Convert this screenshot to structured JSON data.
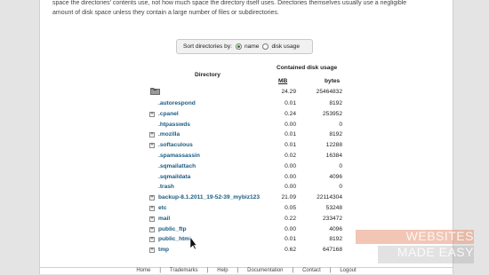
{
  "intro_lines": [
    "space the directories' contents use, not how much space the directory itself uses. Directories themselves usually use a negligible",
    "amount of disk space unless they contain a large number of files or subdirectories."
  ],
  "sort": {
    "label": "Sort directories by:",
    "options": [
      "name",
      "disk usage"
    ],
    "selected": "name"
  },
  "table": {
    "col_directory": "Directory",
    "col_usage": "Contained disk usage",
    "col_mb": "MB",
    "col_bytes": "bytes",
    "root": {
      "mb": "24.29",
      "bytes": "25464832"
    },
    "rows": [
      {
        "name": ".autorespond",
        "mb": "0.01",
        "bytes": "8192",
        "expandable": false
      },
      {
        "name": ".cpanel",
        "mb": "0.24",
        "bytes": "253952",
        "expandable": true
      },
      {
        "name": ".htpasswds",
        "mb": "0.00",
        "bytes": "0",
        "expandable": false
      },
      {
        "name": ".mozilla",
        "mb": "0.01",
        "bytes": "8192",
        "expandable": true
      },
      {
        "name": ".softaculous",
        "mb": "0.01",
        "bytes": "12288",
        "expandable": true
      },
      {
        "name": ".spamassassin",
        "mb": "0.02",
        "bytes": "16384",
        "expandable": false
      },
      {
        "name": ".sqmailattach",
        "mb": "0.00",
        "bytes": "0",
        "expandable": false
      },
      {
        "name": ".sqmaildata",
        "mb": "0.00",
        "bytes": "4096",
        "expandable": false
      },
      {
        "name": ".trash",
        "mb": "0.00",
        "bytes": "0",
        "expandable": false
      },
      {
        "name": "backup-8.1.2011_19-52-39_mybiz123",
        "mb": "21.09",
        "bytes": "22114304",
        "expandable": true
      },
      {
        "name": "etc",
        "mb": "0.05",
        "bytes": "53248",
        "expandable": true
      },
      {
        "name": "mail",
        "mb": "0.22",
        "bytes": "233472",
        "expandable": true
      },
      {
        "name": "public_ftp",
        "mb": "0.00",
        "bytes": "4096",
        "expandable": true
      },
      {
        "name": "public_html",
        "mb": "0.01",
        "bytes": "8192",
        "expandable": true
      },
      {
        "name": "tmp",
        "mb": "0.62",
        "bytes": "647168",
        "expandable": true
      }
    ]
  },
  "footer": [
    "Home",
    "Trademarks",
    "Help",
    "Documentation",
    "Contact",
    "Logout"
  ],
  "watermark": {
    "line1": "WEBSITES",
    "line2": "MADE EASY"
  }
}
